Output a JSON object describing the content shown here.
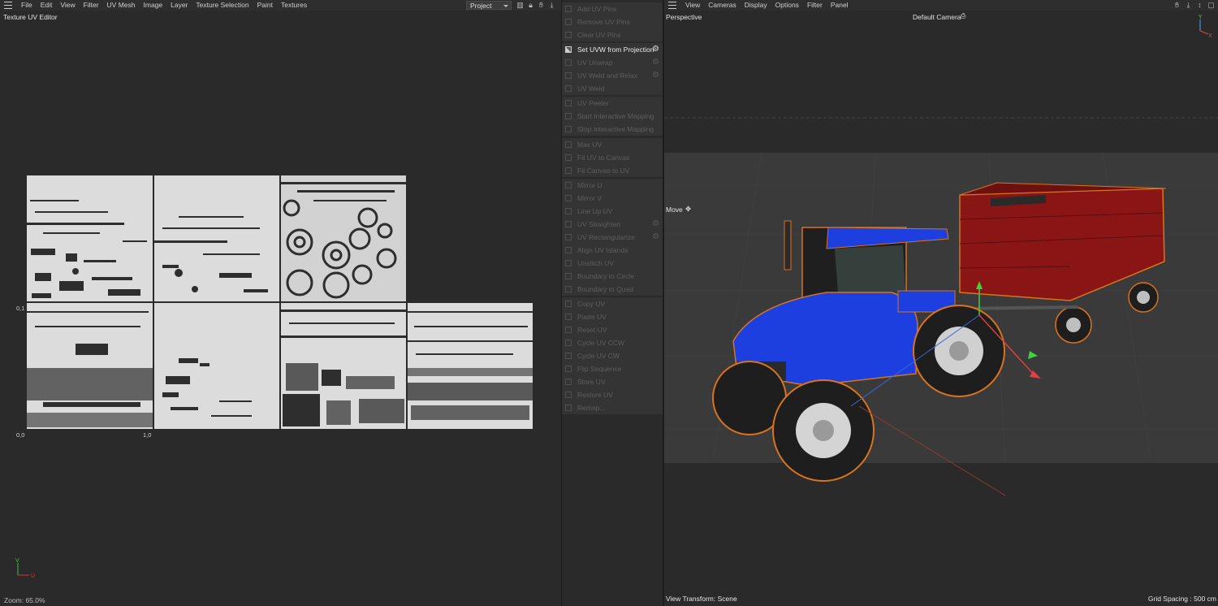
{
  "left_menu": [
    "File",
    "Edit",
    "View",
    "Filter",
    "UV Mesh",
    "Image",
    "Layer",
    "Texture Selection",
    "Paint",
    "Textures"
  ],
  "left_toolbar": {
    "project_select": "Project"
  },
  "uv_editor": {
    "title": "Texture UV Editor",
    "label_v1": "0,1",
    "label_origin": "0,0",
    "label_u1": "1,0",
    "axis_v": "V",
    "axis_u": "U",
    "zoom": "Zoom: 65.0%"
  },
  "command_groups": [
    [
      {
        "label": "Add UV Pins"
      },
      {
        "label": "Remove UV Pins"
      },
      {
        "label": "Clear UV Pins"
      }
    ],
    [
      {
        "label": "Set UVW from Projection",
        "active": true,
        "gear": true
      },
      {
        "label": "UV Unwrap",
        "gear": true
      },
      {
        "label": "UV Weld and Relax",
        "gear": true
      },
      {
        "label": "UV Weld"
      }
    ],
    [
      {
        "label": "UV Peeler"
      },
      {
        "label": "Start Interactive Mapping"
      },
      {
        "label": "Stop Interactive Mapping"
      }
    ],
    [
      {
        "label": "Max UV"
      },
      {
        "label": "Fit UV to Canvas"
      },
      {
        "label": "Fit Canvas to UV"
      }
    ],
    [
      {
        "label": "Mirror U"
      },
      {
        "label": "Mirror V"
      },
      {
        "label": "Line Up UV"
      },
      {
        "label": "UV Straighten",
        "gear": true
      },
      {
        "label": "UV Rectangularize",
        "gear": true
      },
      {
        "label": "Align UV Islands"
      },
      {
        "label": "Unstitch UV"
      },
      {
        "label": "Boundary to Circle"
      },
      {
        "label": "Boundary to Quad"
      }
    ],
    [
      {
        "label": "Copy UV"
      },
      {
        "label": "Paste UV"
      },
      {
        "label": "Reset UV"
      },
      {
        "label": "Cycle UV CCW"
      },
      {
        "label": "Cycle UV CW"
      },
      {
        "label": "Flip Sequence"
      },
      {
        "label": "Store UV"
      },
      {
        "label": "Restore UV"
      },
      {
        "label": "Remap..."
      }
    ]
  ],
  "right_menu": [
    "View",
    "Cameras",
    "Display",
    "Options",
    "Filter",
    "Panel"
  ],
  "viewport": {
    "name": "Perspective",
    "camera": "Default Camera",
    "tool": "Move",
    "view_transform": "View Transform: Scene",
    "grid_spacing": "Grid Spacing : 500 cm",
    "axis_y": "Y",
    "axis_x": "X"
  },
  "colors": {
    "tractor_blue": "#1d3fe0",
    "trailer_red": "#8c1414",
    "selection_orange": "#d8731e",
    "uv_tile": "#dcdcdc"
  }
}
